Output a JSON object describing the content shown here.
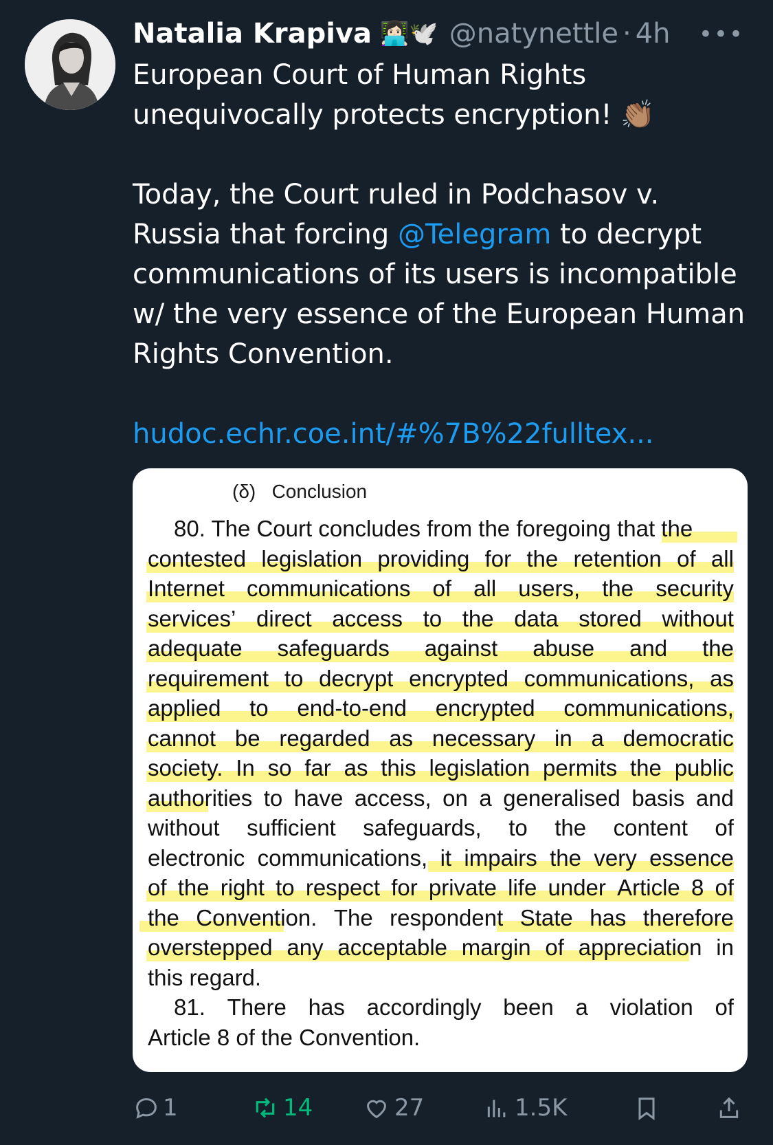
{
  "tweet": {
    "author_name": "Natalia Krapiva",
    "author_emoji": "👩🏻‍💻🕊️",
    "handle": "@natynettle",
    "dot": "·",
    "time": "4h",
    "more": "•••",
    "para1": [
      "European Court of Human Rights",
      "unequivocally protects encryption! 👏🏽"
    ],
    "para2_a": "Today, the Court ruled in Podchasov v. Russia that forcing ",
    "mention": "@Telegram",
    "para2_b": " to decrypt communications of its users is incompatible w/ the very essence of the European Human Rights Convention.",
    "link": "hudoc.echr.coe.int/#%7B%22fulltex..."
  },
  "document_image": {
    "heading": "(δ)   Conclusion",
    "lines": [
      "80.  The Court concludes from the foregoing that the",
      "contested legislation providing for the retention of all",
      "Internet communications of all users, the security",
      "services’ direct access to the data stored without",
      "adequate safeguards against abuse and the",
      "requirement to decrypt encrypted communications, as",
      "applied to end-to-end encrypted communications,",
      "cannot be regarded as necessary in a democratic",
      "society. In so far as this legislation permits the public",
      "authorities to have access, on a generalised basis and",
      "without sufficient safeguards, to the content of",
      "electronic communications, it impairs the very essence",
      "of the right to respect for private life under Article 8 of",
      "the Convention. The respondent State has therefore",
      "overstepped any acceptable margin of appreciation in",
      "this regard.",
      "81.   There has accordingly been a violation of",
      "Article 8 of the Convention."
    ]
  },
  "actions": {
    "reply_count": "1",
    "retweet_count": "14",
    "like_count": "27",
    "views_count": "1.5K"
  },
  "colors": {
    "background": "#15202b",
    "link": "#1d9bf0",
    "muted": "#8b98a5",
    "retweet": "#00ba7c",
    "highlight": "#fbf37a"
  }
}
